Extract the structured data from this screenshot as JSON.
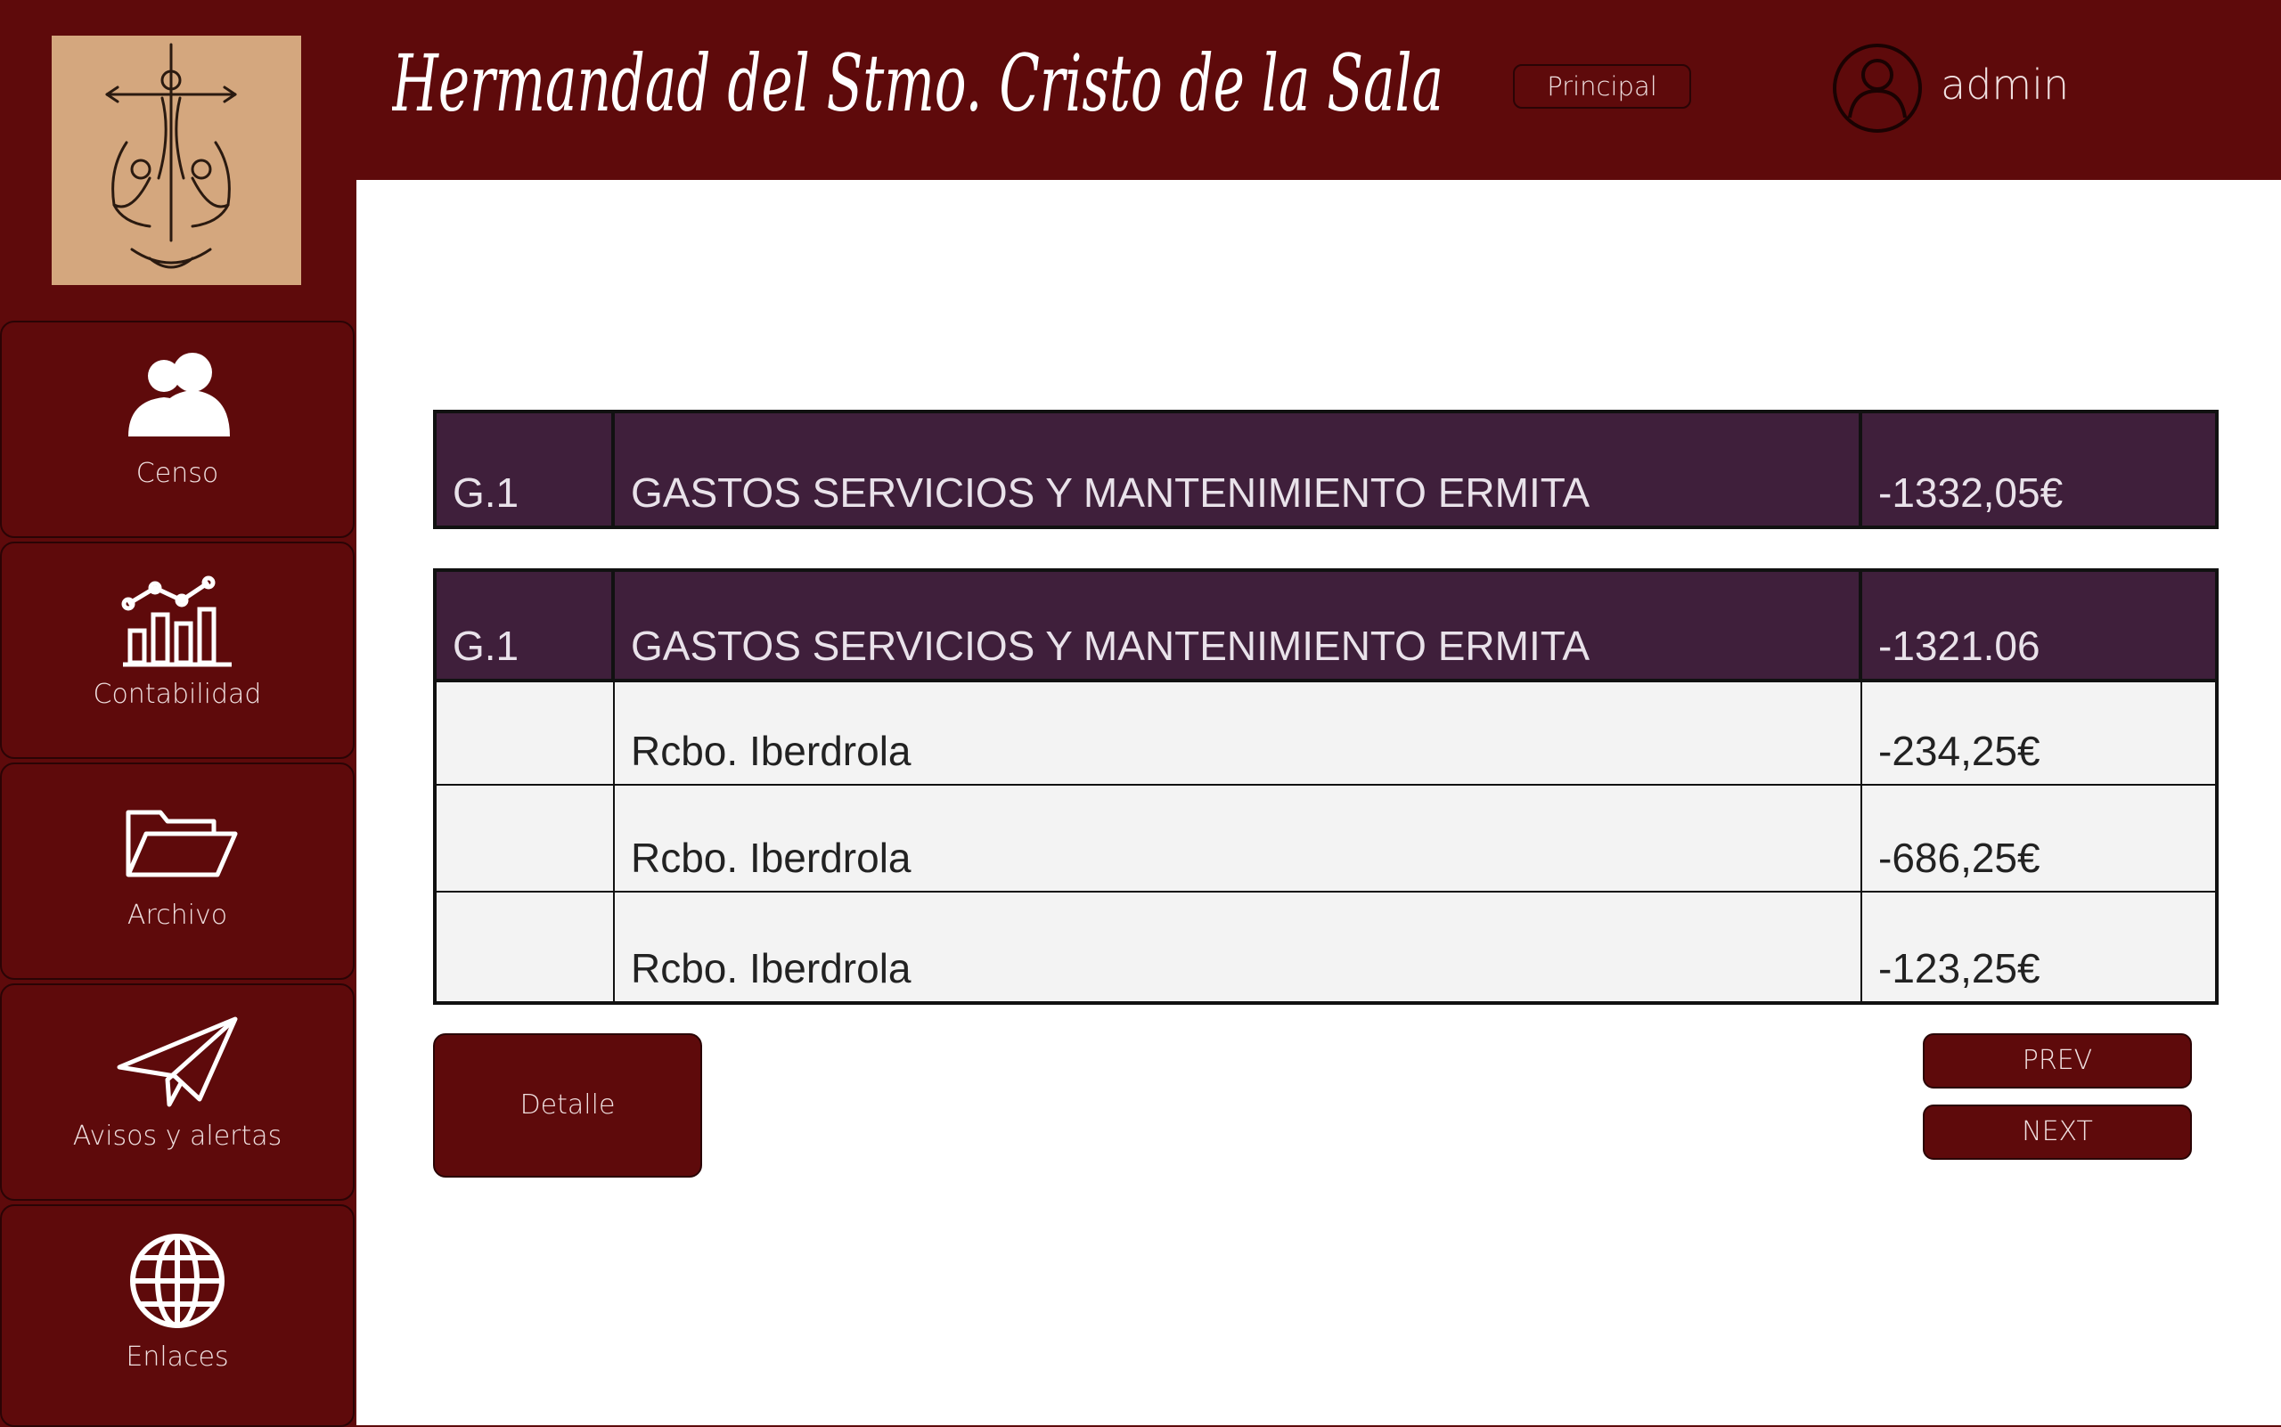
{
  "header": {
    "title": "Hermandad del Stmo. Cristo de la Sala",
    "principal_label": "Principal",
    "username": "admin"
  },
  "sidebar": {
    "items": [
      {
        "label": "Censo",
        "icon": "users-icon"
      },
      {
        "label": "Contabilidad",
        "icon": "chart-icon"
      },
      {
        "label": "Archivo",
        "icon": "folder-icon"
      },
      {
        "label": "Avisos y alertas",
        "icon": "paper-plane-icon"
      },
      {
        "label": "Enlaces",
        "icon": "globe-icon"
      }
    ]
  },
  "summary": {
    "code": "G.1",
    "description": "GASTOS SERVICIOS Y MANTENIMIENTO ERMITA",
    "amount": "-1332,05€"
  },
  "detail": {
    "header": {
      "code": "G.1",
      "description": "GASTOS SERVICIOS Y MANTENIMIENTO ERMITA",
      "amount": "-1321.06"
    },
    "rows": [
      {
        "code": "",
        "description": "Rcbo. Iberdrola",
        "amount": "-234,25€"
      },
      {
        "code": "",
        "description": "Rcbo. Iberdrola",
        "amount": "-686,25€"
      },
      {
        "code": "",
        "description": "Rcbo. Iberdrola",
        "amount": "-123,25€"
      }
    ]
  },
  "buttons": {
    "detalle": "Detalle",
    "prev": "PREV",
    "next": "NEXT"
  },
  "colors": {
    "brand": "#5e0a0b",
    "table_header": "#3f1f3b",
    "logo_bg": "#d4a77e",
    "row_bg": "#f3f3f3"
  }
}
